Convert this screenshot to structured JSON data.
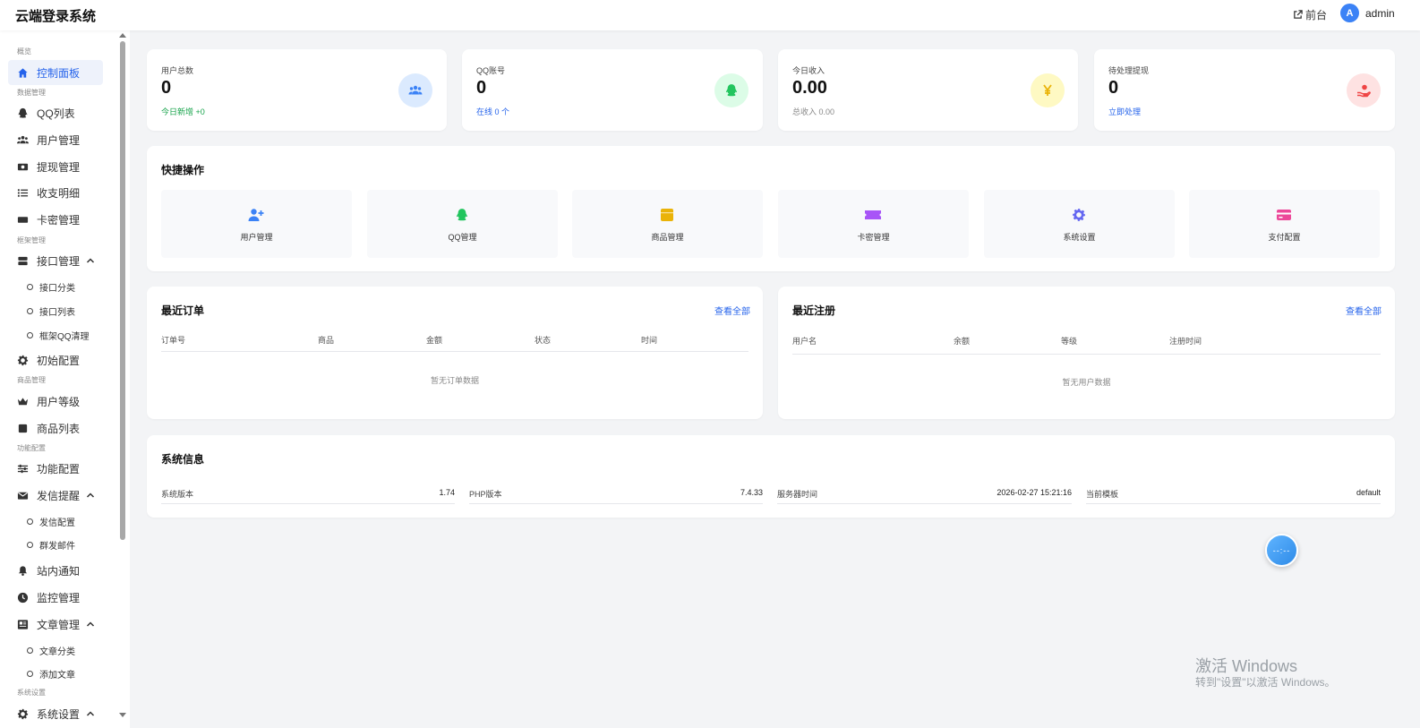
{
  "header": {
    "brand": "云端登录系统",
    "front_label": "前台",
    "avatar_letter": "A",
    "username": "admin"
  },
  "sidebar": {
    "sections": {
      "overview": "概览",
      "data": "数据管理",
      "framework": "框架管理",
      "goods": "商品管理",
      "feature": "功能配置",
      "system": "系统设置"
    },
    "items": {
      "dashboard": "控制面板",
      "qq_list": "QQ列表",
      "users": "用户管理",
      "withdraw": "提现管理",
      "ledger": "收支明细",
      "cards": "卡密管理",
      "api": "接口管理",
      "api_category": "接口分类",
      "api_list": "接口列表",
      "frame_qq_clean": "框架QQ清理",
      "init_config": "初始配置",
      "user_level": "用户等级",
      "goods_list": "商品列表",
      "feature_config": "功能配置",
      "mail_remind": "发信提醒",
      "mail_config": "发信配置",
      "bulk_mail": "群发邮件",
      "notice": "站内通知",
      "monitor": "监控管理",
      "articles": "文章管理",
      "article_category": "文章分类",
      "add_article": "添加文章",
      "system_settings": "系统设置"
    }
  },
  "stats": [
    {
      "label": "用户总数",
      "value": "0",
      "sub": "今日新增 +0",
      "sub_color": "#16a34a",
      "icon": "users-icon",
      "icon_bg": "#dbeafe",
      "icon_color": "#3b82f6"
    },
    {
      "label": "QQ账号",
      "value": "0",
      "sub": "在线 0 个",
      "sub_color": "#2563eb",
      "icon": "qq-icon",
      "icon_bg": "#dcfce7",
      "icon_color": "#22c55e"
    },
    {
      "label": "今日收入",
      "value": "0.00",
      "sub": "总收入 0.00",
      "sub_color": "#888888",
      "icon": "yen-icon",
      "icon_bg": "#fef9c3",
      "icon_color": "#eab308"
    },
    {
      "label": "待处理提现",
      "value": "0",
      "sub": "立即处理",
      "sub_color": "#2563eb",
      "icon": "hand-coin-icon",
      "icon_bg": "#fee2e2",
      "icon_color": "#ef4444"
    }
  ],
  "quick": {
    "title": "快捷操作",
    "items": [
      {
        "label": "用户管理",
        "icon": "user-plus-icon",
        "color": "#3b82f6"
      },
      {
        "label": "QQ管理",
        "icon": "qq-icon",
        "color": "#22c55e"
      },
      {
        "label": "商品管理",
        "icon": "box-icon",
        "color": "#eab308"
      },
      {
        "label": "卡密管理",
        "icon": "ticket-icon",
        "color": "#a855f7"
      },
      {
        "label": "系统设置",
        "icon": "gear-icon",
        "color": "#6366f1"
      },
      {
        "label": "支付配置",
        "icon": "credit-card-icon",
        "color": "#ec4899"
      }
    ]
  },
  "orders": {
    "title": "最近订单",
    "view_all": "查看全部",
    "columns": [
      "订单号",
      "商品",
      "金额",
      "状态",
      "时间"
    ],
    "empty": "暂无订单数据"
  },
  "registrations": {
    "title": "最近注册",
    "view_all": "查看全部",
    "columns": [
      "用户名",
      "余额",
      "等级",
      "注册时间"
    ],
    "empty": "暂无用户数据"
  },
  "system_info": {
    "title": "系统信息",
    "rows": [
      {
        "label": "系统版本",
        "value": "1.74"
      },
      {
        "label": "PHP版本",
        "value": "7.4.33"
      },
      {
        "label": "服务器时间",
        "value": "2026-02-27 15:21:16"
      },
      {
        "label": "当前模板",
        "value": "default"
      }
    ]
  },
  "fab": {
    "text": "--:--"
  },
  "watermark": {
    "title": "激活 Windows",
    "sub": "转到\"设置\"以激活 Windows。"
  }
}
